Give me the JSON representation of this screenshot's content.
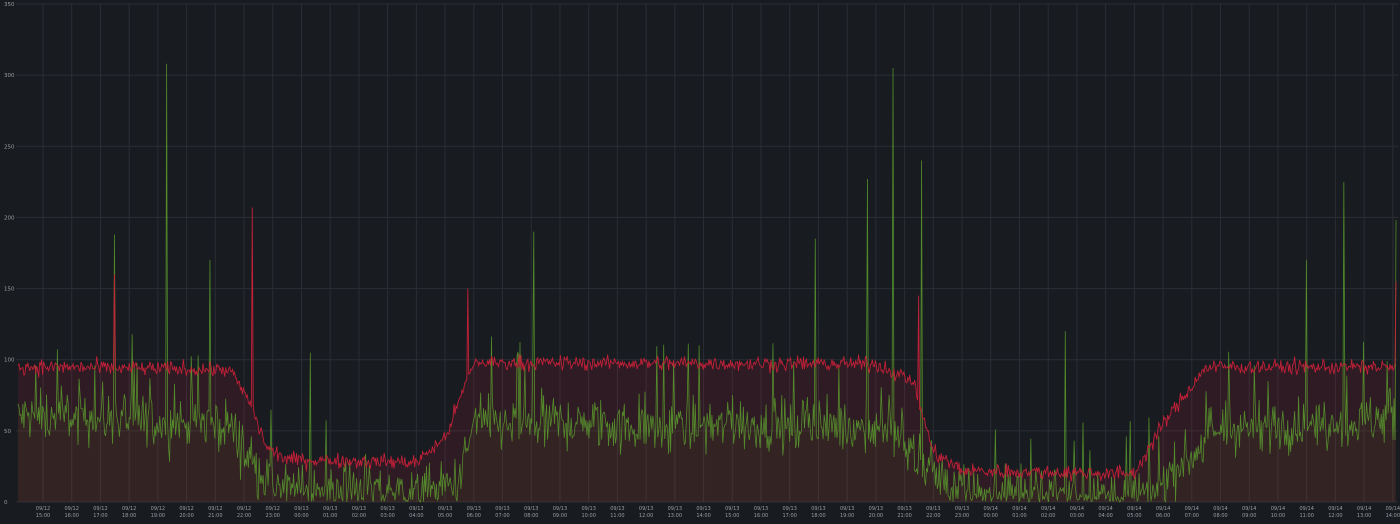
{
  "colors": {
    "background": "#181b1f",
    "grid": "#2a2e35",
    "tick_text": "#9a9da3",
    "series_red": "#c8213a",
    "series_green": "#5c9e2e"
  },
  "chart_data": {
    "type": "line",
    "title": "",
    "xlabel": "",
    "ylabel": "",
    "ylim": [
      0,
      350
    ],
    "yticks": [
      "0",
      "50",
      "100",
      "150",
      "200",
      "250",
      "300",
      "350"
    ],
    "grid": true,
    "legend": "none",
    "xticks": [
      [
        "09/12",
        "15:00"
      ],
      [
        "09/12",
        "16:00"
      ],
      [
        "09/12",
        "17:00"
      ],
      [
        "09/12",
        "18:00"
      ],
      [
        "09/12",
        "19:00"
      ],
      [
        "09/12",
        "20:00"
      ],
      [
        "09/12",
        "21:00"
      ],
      [
        "09/12",
        "22:00"
      ],
      [
        "09/12",
        "23:00"
      ],
      [
        "09/13",
        "00:00"
      ],
      [
        "09/13",
        "01:00"
      ],
      [
        "09/13",
        "02:00"
      ],
      [
        "09/13",
        "03:00"
      ],
      [
        "09/13",
        "04:00"
      ],
      [
        "09/13",
        "05:00"
      ],
      [
        "09/13",
        "06:00"
      ],
      [
        "09/13",
        "07:00"
      ],
      [
        "09/13",
        "08:00"
      ],
      [
        "09/13",
        "09:00"
      ],
      [
        "09/13",
        "10:00"
      ],
      [
        "09/13",
        "11:00"
      ],
      [
        "09/13",
        "12:00"
      ],
      [
        "09/13",
        "13:00"
      ],
      [
        "09/13",
        "14:00"
      ],
      [
        "09/13",
        "15:00"
      ],
      [
        "09/13",
        "16:00"
      ],
      [
        "09/13",
        "17:00"
      ],
      [
        "09/13",
        "18:00"
      ],
      [
        "09/13",
        "19:00"
      ],
      [
        "09/13",
        "20:00"
      ],
      [
        "09/13",
        "21:00"
      ],
      [
        "09/13",
        "22:00"
      ],
      [
        "09/13",
        "23:00"
      ],
      [
        "09/14",
        "00:00"
      ],
      [
        "09/14",
        "01:00"
      ],
      [
        "09/14",
        "02:00"
      ],
      [
        "09/14",
        "03:00"
      ],
      [
        "09/14",
        "04:00"
      ],
      [
        "09/14",
        "05:00"
      ],
      [
        "09/14",
        "06:00"
      ],
      [
        "09/14",
        "07:00"
      ],
      [
        "09/14",
        "08:00"
      ],
      [
        "09/14",
        "09:00"
      ],
      [
        "09/14",
        "10:00"
      ],
      [
        "09/14",
        "11:00"
      ],
      [
        "09/14",
        "12:00"
      ],
      [
        "09/14",
        "13:00"
      ],
      [
        "09/14",
        "14:00"
      ]
    ],
    "series": [
      {
        "color": "#c8213a",
        "baseline": [
          [
            0,
            95
          ],
          [
            6.5,
            93
          ],
          [
            7.2,
            70
          ],
          [
            7.8,
            38
          ],
          [
            8.5,
            30
          ],
          [
            13,
            28
          ],
          [
            14,
            45
          ],
          [
            15,
            98
          ],
          [
            29,
            97
          ],
          [
            30.3,
            85
          ],
          [
            31,
            35
          ],
          [
            32,
            22
          ],
          [
            38,
            20
          ],
          [
            39,
            55
          ],
          [
            40.5,
            95
          ],
          [
            47.5,
            95
          ]
        ],
        "spread": 9,
        "spikes": [
          [
            7.3,
            207
          ],
          [
            2.5,
            160
          ],
          [
            30.5,
            145
          ],
          [
            14.8,
            150
          ],
          [
            47.3,
            155
          ]
        ]
      },
      {
        "color": "#5c9e2e",
        "baseline": [
          [
            0,
            60
          ],
          [
            6.5,
            55
          ],
          [
            7.5,
            20
          ],
          [
            8.5,
            8
          ],
          [
            13.5,
            6
          ],
          [
            14.5,
            15
          ],
          [
            15,
            55
          ],
          [
            29.5,
            52
          ],
          [
            31,
            20
          ],
          [
            32,
            5
          ],
          [
            38.5,
            4
          ],
          [
            39.5,
            25
          ],
          [
            41,
            50
          ],
          [
            47.5,
            60
          ]
        ],
        "spread": 22,
        "spikes": [
          [
            4.3,
            308
          ],
          [
            29.6,
            305
          ],
          [
            30.6,
            240
          ],
          [
            28.7,
            227
          ],
          [
            45.3,
            225
          ],
          [
            47.2,
            198
          ],
          [
            17.1,
            190
          ],
          [
            2.5,
            188
          ],
          [
            5.8,
            170
          ],
          [
            26.9,
            185
          ],
          [
            44,
            170
          ],
          [
            35.6,
            120
          ],
          [
            9.3,
            105
          ]
        ]
      }
    ]
  }
}
